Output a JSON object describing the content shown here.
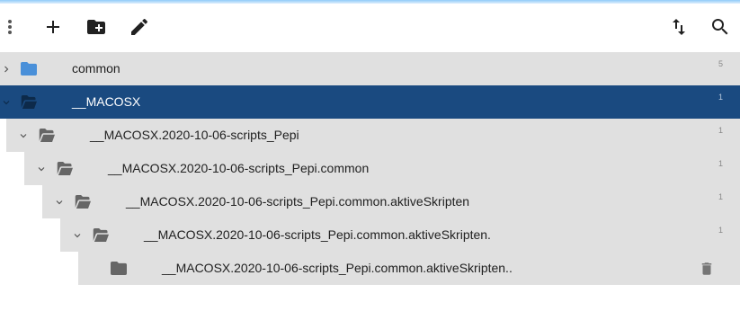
{
  "colors": {
    "row_bg": "#e0e0e0",
    "selected_bg": "#1a4a80",
    "folder_blue": "#4a90d9",
    "icon_dark": "#212121",
    "icon_gray": "#666666"
  },
  "toolbar": {
    "icons": [
      "more-vert-icon",
      "add-icon",
      "create-folder-icon",
      "edit-icon",
      "sort-icon",
      "search-icon"
    ]
  },
  "tree": {
    "rows": [
      {
        "label": "common",
        "count": "5",
        "expanded": false,
        "selected": false,
        "icon": "folder-icon"
      },
      {
        "label": "__MACOSX",
        "count": "1",
        "expanded": true,
        "selected": true,
        "icon": "folder-open-icon"
      },
      {
        "label": "__MACOSX.2020-10-06-scripts_Pepi",
        "count": "1",
        "expanded": true,
        "selected": false,
        "icon": "folder-open-icon"
      },
      {
        "label": "__MACOSX.2020-10-06-scripts_Pepi.common",
        "count": "1",
        "expanded": true,
        "selected": false,
        "icon": "folder-open-icon"
      },
      {
        "label": "__MACOSX.2020-10-06-scripts_Pepi.common.aktiveSkripten",
        "count": "1",
        "expanded": true,
        "selected": false,
        "icon": "folder-open-icon"
      },
      {
        "label": "__MACOSX.2020-10-06-scripts_Pepi.common.aktiveSkripten.",
        "count": "1",
        "expanded": true,
        "selected": false,
        "icon": "folder-open-icon"
      },
      {
        "label": "__MACOSX.2020-10-06-scripts_Pepi.common.aktiveSkripten..",
        "count": "",
        "expanded": null,
        "selected": false,
        "icon": "folder-icon",
        "action_icon": "delete-icon"
      }
    ]
  }
}
